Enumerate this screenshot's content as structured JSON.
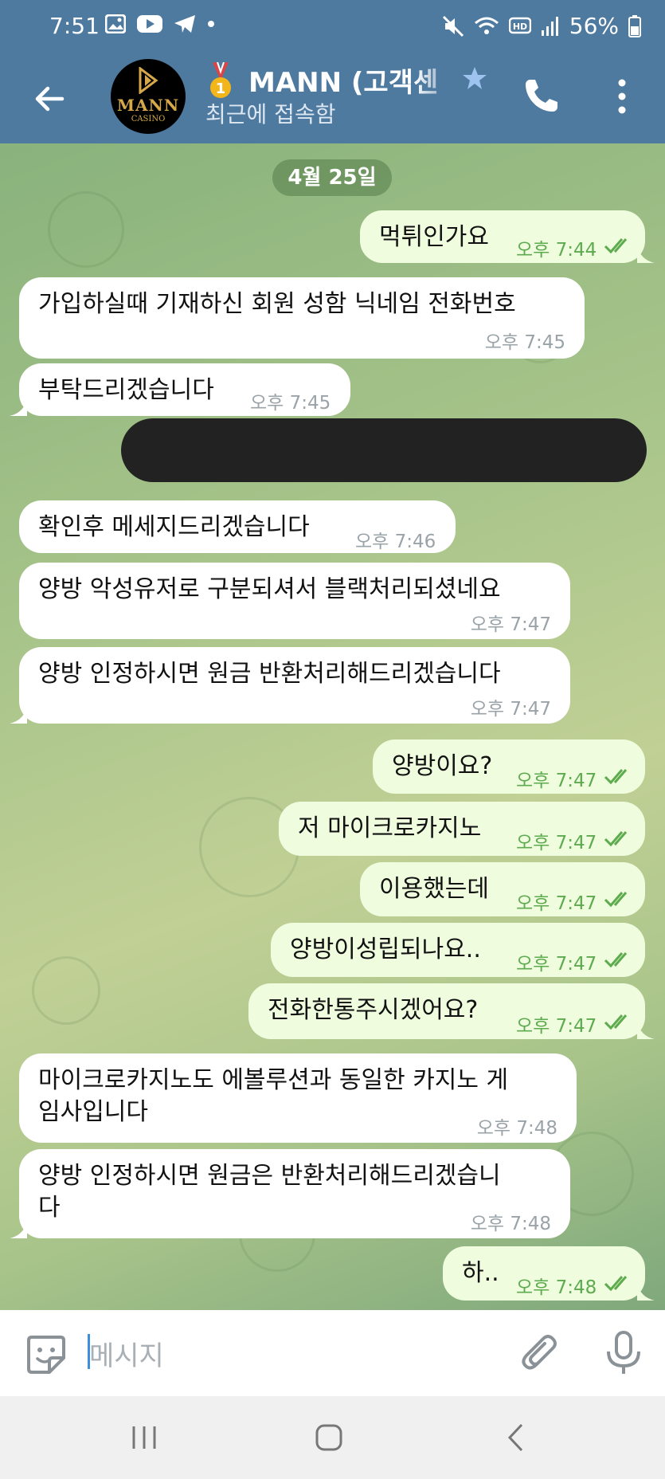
{
  "status_bar": {
    "time": "7:51",
    "battery": "56%",
    "icons_left": [
      "gallery-icon",
      "youtube-icon",
      "telegram-icon",
      "dot-icon"
    ],
    "icons_right": [
      "mute-icon",
      "wifi-icon",
      "hd-icon",
      "signal-icon",
      "battery-icon"
    ]
  },
  "header": {
    "title": "MANN (고객센",
    "subtitle": "최근에 접속함",
    "avatar_text": "MANN",
    "avatar_sub": "CASINO",
    "medal_number": "1"
  },
  "date_divider": "4월 25일",
  "messages": [
    {
      "dir": "out",
      "text": "먹튀인가요",
      "time": "오후 7:44"
    },
    {
      "dir": "in",
      "text": "가입하실때 기재하신 회원 성함 닉네임 전화번호",
      "time": "오후 7:45"
    },
    {
      "dir": "in",
      "text": "부탁드리겠습니다",
      "time": "오후 7:45"
    },
    {
      "dir": "in",
      "text": "확인후 메세지드리겠습니다",
      "time": "오후 7:46"
    },
    {
      "dir": "in",
      "text": "양방 악성유저로 구분되셔서 블랙처리되셨네요",
      "time": "오후 7:47"
    },
    {
      "dir": "in",
      "text": "양방 인정하시면 원금 반환처리해드리겠습니다",
      "time": "오후 7:47"
    },
    {
      "dir": "out",
      "text": "양방이요?",
      "time": "오후 7:47"
    },
    {
      "dir": "out",
      "text": "저 마이크로카지노",
      "time": "오후 7:47"
    },
    {
      "dir": "out",
      "text": "이용했는데",
      "time": "오후 7:47"
    },
    {
      "dir": "out",
      "text": "양방이성립되나요..",
      "time": "오후 7:47"
    },
    {
      "dir": "out",
      "text": "전화한통주시겠어요?",
      "time": "오후 7:47"
    },
    {
      "dir": "in",
      "text": "마이크로카지노도 에볼루션과 동일한 카지노 게\n임사입니다",
      "time": "오후 7:48"
    },
    {
      "dir": "in",
      "text": "양방 인정하시면 원금은 반환처리해드리겠습니\n다",
      "time": "오후 7:48"
    },
    {
      "dir": "out",
      "text": "하..",
      "time": "오후 7:48"
    }
  ],
  "input": {
    "placeholder": "메시지"
  }
}
